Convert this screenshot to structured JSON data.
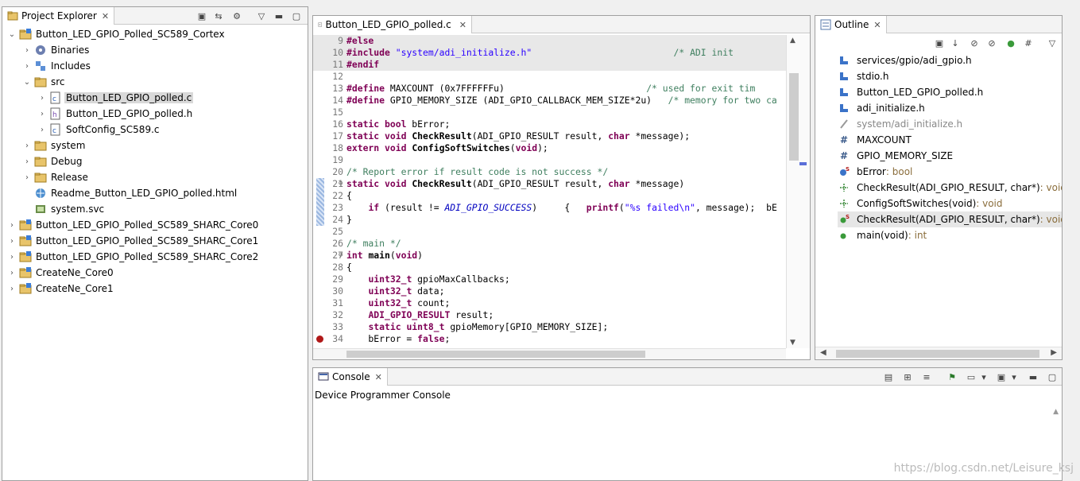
{
  "project_explorer": {
    "title": "Project Explorer",
    "items": [
      {
        "label": "Button_LED_GPIO_Polled_SC589_Cortex",
        "depth": 0,
        "expanded": true,
        "icon": "project-folder-icon"
      },
      {
        "label": "Binaries",
        "depth": 1,
        "expanded": false,
        "icon": "binaries-icon"
      },
      {
        "label": "Includes",
        "depth": 1,
        "expanded": false,
        "icon": "includes-icon"
      },
      {
        "label": "src",
        "depth": 1,
        "expanded": true,
        "icon": "folder-icon"
      },
      {
        "label": "Button_LED_GPIO_polled.c",
        "depth": 2,
        "expanded": false,
        "icon": "c-file-icon",
        "selected": true
      },
      {
        "label": "Button_LED_GPIO_polled.h",
        "depth": 2,
        "expanded": false,
        "icon": "h-file-icon"
      },
      {
        "label": "SoftConfig_SC589.c",
        "depth": 2,
        "expanded": false,
        "icon": "c-file-icon"
      },
      {
        "label": "system",
        "depth": 1,
        "expanded": false,
        "icon": "folder-icon"
      },
      {
        "label": "Debug",
        "depth": 1,
        "expanded": false,
        "icon": "folder-icon"
      },
      {
        "label": "Release",
        "depth": 1,
        "expanded": false,
        "icon": "folder-icon"
      },
      {
        "label": "Readme_Button_LED_GPIO_polled.html",
        "depth": 1,
        "leaf": true,
        "icon": "html-file-icon"
      },
      {
        "label": "system.svc",
        "depth": 1,
        "leaf": true,
        "icon": "svc-file-icon"
      },
      {
        "label": "Button_LED_GPIO_Polled_SC589_SHARC_Core0",
        "depth": 0,
        "expanded": false,
        "icon": "project-folder-icon"
      },
      {
        "label": "Button_LED_GPIO_Polled_SC589_SHARC_Core1",
        "depth": 0,
        "expanded": false,
        "icon": "project-folder-icon"
      },
      {
        "label": "Button_LED_GPIO_Polled_SC589_SHARC_Core2",
        "depth": 0,
        "expanded": false,
        "icon": "project-folder-icon"
      },
      {
        "label": "CreateNe_Core0",
        "depth": 0,
        "expanded": false,
        "icon": "project-folder-icon"
      },
      {
        "label": "CreateNe_Core1",
        "depth": 0,
        "expanded": false,
        "icon": "project-folder-icon"
      }
    ]
  },
  "editor": {
    "tab": "Button_LED_GPIO_polled.c",
    "lines": [
      {
        "n": "9",
        "grey": true,
        "html": "<span class=\"pp\">#else</span>"
      },
      {
        "n": "10",
        "grey": true,
        "html": "<span class=\"pp\">#include</span> <span class=\"str\">\"system/adi_initialize.h\"</span>                          <span class=\"cm\">/* ADI init</span>"
      },
      {
        "n": "11",
        "grey": true,
        "html": "<span class=\"pp\">#endif</span>"
      },
      {
        "n": "12",
        "html": ""
      },
      {
        "n": "13",
        "html": "<span class=\"pp\">#define</span> MAXCOUNT (0x7FFFFFFu)                          <span class=\"cm\">/* used for exit tim</span>"
      },
      {
        "n": "14",
        "html": "<span class=\"pp\">#define</span> GPIO_MEMORY_SIZE (ADI_GPIO_CALLBACK_MEM_SIZE*2u)   <span class=\"cm\">/* memory for two ca</span>"
      },
      {
        "n": "15",
        "html": ""
      },
      {
        "n": "16",
        "html": "<span class=\"kw\">static</span> <span class=\"kw\">bool</span> bError;"
      },
      {
        "n": "17",
        "html": "<span class=\"kw\">static</span> <span class=\"kw\">void</span> <b>CheckResult</b>(ADI_GPIO_RESULT result, <span class=\"kw\">char</span> *message);"
      },
      {
        "n": "18",
        "html": "<span class=\"kw\">extern</span> <span class=\"kw\">void</span> <b>ConfigSoftSwitches</b>(<span class=\"kw\">void</span>);"
      },
      {
        "n": "19",
        "html": ""
      },
      {
        "n": "20",
        "html": "<span class=\"cm\">/* Report error if result code is not success */</span>"
      },
      {
        "n": "21",
        "html": "<span class=\"kw\">static</span> <span class=\"kw\">void</span> <b>CheckResult</b>(ADI_GPIO_RESULT result, <span class=\"kw\">char</span> *message)"
      },
      {
        "n": "22",
        "html": "{"
      },
      {
        "n": "23",
        "html": "    <span class=\"kw\">if</span> (result != <span class=\"it\">ADI_GPIO_SUCCESS</span>)     {   <span class=\"kw\">printf</span>(<span class=\"str\">\"%s failed\\n\"</span>, message);  bE"
      },
      {
        "n": "24",
        "html": "}"
      },
      {
        "n": "25",
        "html": ""
      },
      {
        "n": "26",
        "html": "<span class=\"cm\">/* main */</span>"
      },
      {
        "n": "27",
        "html": "<span class=\"kw\">int</span> <b>main</b>(<span class=\"kw\">void</span>)"
      },
      {
        "n": "28",
        "html": "{"
      },
      {
        "n": "29",
        "html": "    <span class=\"kw\">uint32_t</span> gpioMaxCallbacks;"
      },
      {
        "n": "30",
        "html": "    <span class=\"kw\">uint32_t</span> data;"
      },
      {
        "n": "31",
        "html": "    <span class=\"kw\">uint32_t</span> count;"
      },
      {
        "n": "32",
        "html": "    <span class=\"kw\">ADI_GPIO_RESULT</span> result;"
      },
      {
        "n": "33",
        "html": "    <span class=\"kw\">static</span> <span class=\"kw\">uint8_t</span> gpioMemory[GPIO_MEMORY_SIZE];"
      },
      {
        "n": "34",
        "html": "    bError = <span class=\"kw\">false</span>;"
      }
    ]
  },
  "outline": {
    "title": "Outline",
    "items": [
      {
        "label": "services/gpio/adi_gpio.h",
        "type": "",
        "icon": "include-icon",
        "kind": "inc"
      },
      {
        "label": "stdio.h",
        "type": "",
        "icon": "include-icon",
        "kind": "inc"
      },
      {
        "label": "Button_LED_GPIO_polled.h",
        "type": "",
        "icon": "include-icon",
        "kind": "inc"
      },
      {
        "label": "adi_initialize.h",
        "type": "",
        "icon": "include-icon",
        "kind": "inc"
      },
      {
        "label": "system/adi_initialize.h",
        "type": "",
        "icon": "include-disabled-icon",
        "kind": "incdis"
      },
      {
        "label": "MAXCOUNT",
        "type": "",
        "icon": "macro-icon",
        "kind": "macro"
      },
      {
        "label": "GPIO_MEMORY_SIZE",
        "type": "",
        "icon": "macro-icon",
        "kind": "macro"
      },
      {
        "label": "bError",
        "type": " : bool",
        "icon": "static-variable-icon",
        "kind": "var"
      },
      {
        "label": "CheckResult(ADI_GPIO_RESULT, char*)",
        "type": " : void",
        "icon": "function-declaration-icon",
        "kind": "decl"
      },
      {
        "label": "ConfigSoftSwitches(void)",
        "type": " : void",
        "icon": "function-declaration-icon",
        "kind": "decl"
      },
      {
        "label": "CheckResult(ADI_GPIO_RESULT, char*)",
        "type": " : void",
        "icon": "static-function-icon",
        "kind": "func",
        "selected": true
      },
      {
        "label": "main(void)",
        "type": " : int",
        "icon": "function-icon",
        "kind": "func"
      }
    ]
  },
  "console": {
    "title": "Console",
    "subtitle": "Device Programmer Console"
  },
  "watermark": "https://blog.csdn.net/Leisure_ksj"
}
